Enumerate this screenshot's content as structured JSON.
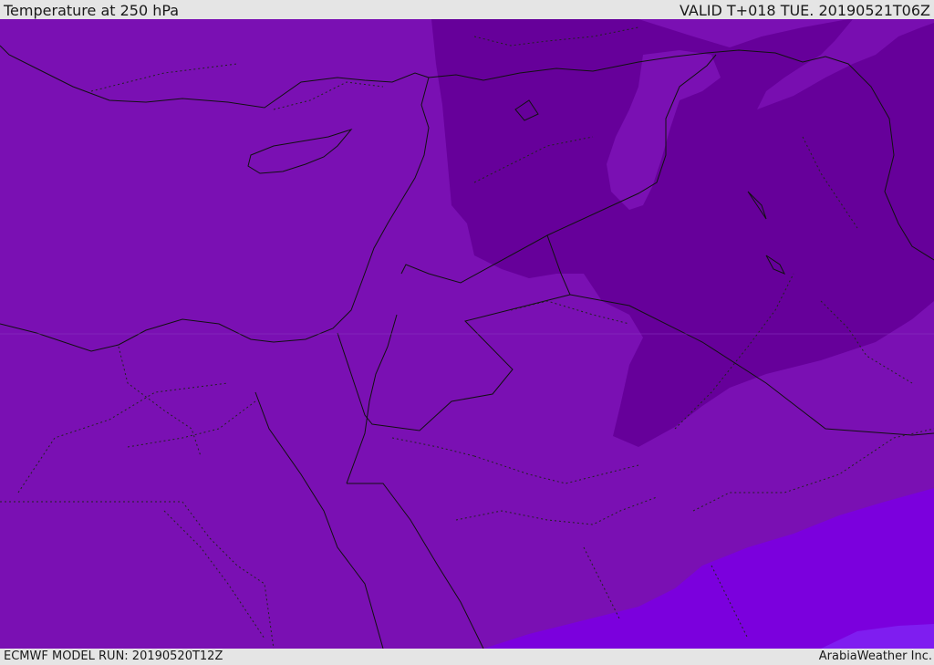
{
  "header": {
    "title": "Temperature at 250 hPa",
    "valid": "VALID T+018 TUE. 20190521T06Z"
  },
  "footer": {
    "model_run": "ECMWF MODEL RUN: 20190520T12Z",
    "credit": "ArabiaWeather Inc."
  },
  "colors": {
    "base": "#7a10b3",
    "cold": "#66009a",
    "warm": "#7b00dd",
    "warmer": "#7f1df0",
    "border": "#111111",
    "bar": "#e5e5e5"
  }
}
